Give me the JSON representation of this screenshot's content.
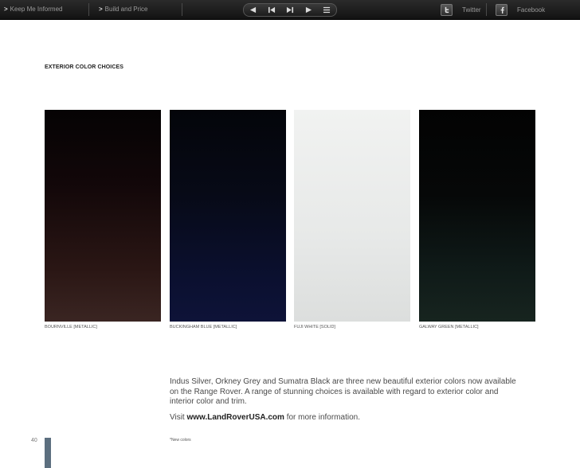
{
  "toolbar": {
    "keep_informed": "Keep Me Informed",
    "build_price": "Build and Price",
    "link_arrow": ">",
    "nav_buttons": [
      "previous-page",
      "first-page",
      "next-page",
      "last-page",
      "menu"
    ],
    "twitter": "Twitter",
    "facebook": "Facebook"
  },
  "page": {
    "section_title": "EXTERIOR COLOR CHOICES",
    "swatches": [
      {
        "label": "BOURNVILLE [METALLIC]",
        "color": "#2a1614"
      },
      {
        "label": "BUCKINGHAM BLUE [METALLIC]",
        "color": "#0b1030"
      },
      {
        "label": "FUJI WHITE [SOLID]",
        "color": "#e7e9e8"
      },
      {
        "label": "GALWAY GREEN [METALLIC]",
        "color": "#0f1a18"
      }
    ],
    "body": "Indus Silver, Orkney Grey and Sumatra Black are three new beautiful exterior colors now available on the Range Rover. A range of stunning choices is available with regard to exterior color and interior color and trim.",
    "visit_prefix": "Visit",
    "visit_url": "www.LandRoverUSA.com",
    "visit_suffix": "for more information.",
    "footnote": "*New colors",
    "page_number": "40"
  },
  "colors": {
    "toolbar_bg": "#1a1a1a",
    "page_bar": "#5c6f7f"
  }
}
